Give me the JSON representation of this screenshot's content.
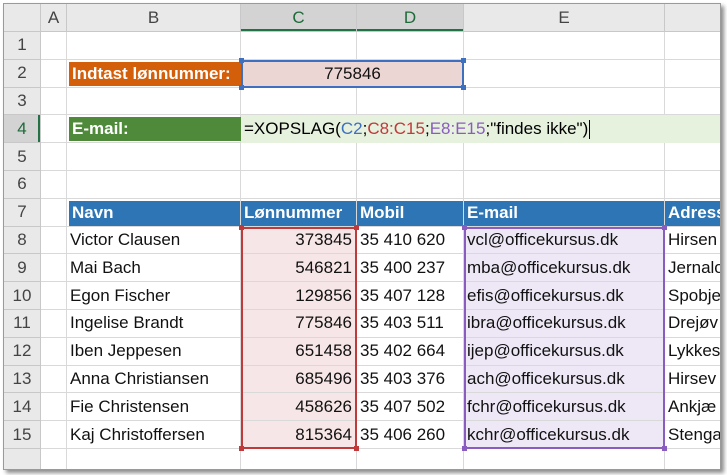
{
  "columns": [
    "A",
    "B",
    "C",
    "D",
    "E"
  ],
  "rows": [
    "1",
    "2",
    "3",
    "4",
    "5",
    "6",
    "7",
    "8",
    "9",
    "10",
    "11",
    "12",
    "13",
    "14",
    "15"
  ],
  "input": {
    "label": "Indtast lønnummer:",
    "value": "775846"
  },
  "result": {
    "label": "E-mail:",
    "formula_prefix": "=XOPSLAG(",
    "ref_lookup": "C2",
    "sep1": ";",
    "ref_lookup_array": "C8:C15",
    "sep2": ";",
    "ref_return_array": "E8:E15",
    "formula_suffix": ";\"findes ikke\")"
  },
  "table": {
    "headers": [
      "Navn",
      "Lønnummer",
      "Mobil",
      "E-mail",
      "Adress"
    ],
    "rows": [
      [
        "Victor Clausen",
        "373845",
        "35 410 620",
        "vcl@officekursus.dk",
        "Hirsen"
      ],
      [
        "Mai Bach",
        "546821",
        "35 400 237",
        "mba@officekursus.dk",
        "Jernalo"
      ],
      [
        "Egon Fischer",
        "129856",
        "35 407 128",
        "efis@officekursus.dk",
        "Spobje"
      ],
      [
        "Ingelise Brandt",
        "775846",
        "35 403 511",
        "ibra@officekursus.dk",
        "Drejøv"
      ],
      [
        "Iben Jeppesen",
        "651458",
        "35 402 664",
        "ijep@officekursus.dk",
        "Lykkes"
      ],
      [
        "Anna Christiansen",
        "685496",
        "35 403 376",
        "ach@officekursus.dk",
        "Hirsev"
      ],
      [
        "Fie Christensen",
        "458626",
        "35 407 502",
        "fchr@officekursus.dk",
        "Ankjæ"
      ],
      [
        "Kaj Christoffersen",
        "815364",
        "35 406 260",
        "kchr@officekursus.dk",
        "Stenga"
      ]
    ]
  },
  "colors": {
    "ref_lookup": "#3f6fbf",
    "ref_lookup_array": "#c0393b",
    "ref_return_array": "#8a5cc0",
    "header_fill": "#2e75b6",
    "label_orange": "#d35f0b",
    "label_green": "#4f8a3a"
  }
}
